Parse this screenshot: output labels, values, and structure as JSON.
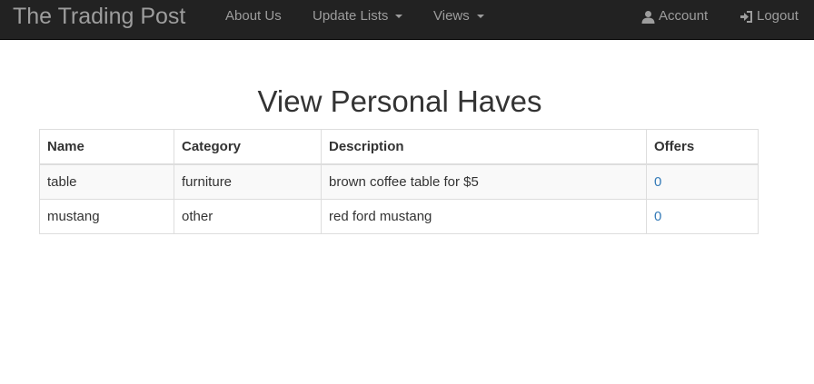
{
  "navbar": {
    "brand": "The Trading Post",
    "about": "About Us",
    "update_lists": "Update Lists",
    "views": "Views",
    "account": "Account",
    "logout": "Logout",
    "icons": {
      "account": "user-icon",
      "logout": "log-in-icon"
    }
  },
  "page": {
    "title": "View Personal Haves"
  },
  "table": {
    "headers": [
      "Name",
      "Category",
      "Description",
      "Offers"
    ],
    "rows": [
      {
        "name": "table",
        "category": "furniture",
        "description": "brown coffee table for $5",
        "offers": "0"
      },
      {
        "name": "mustang",
        "category": "other",
        "description": "red ford mustang",
        "offers": "0"
      }
    ]
  },
  "colors": {
    "navbar_bg": "#222222",
    "navbar_text": "#9d9d9d",
    "link": "#337ab7",
    "stripe": "#f9f9f9",
    "border": "#dddddd"
  }
}
